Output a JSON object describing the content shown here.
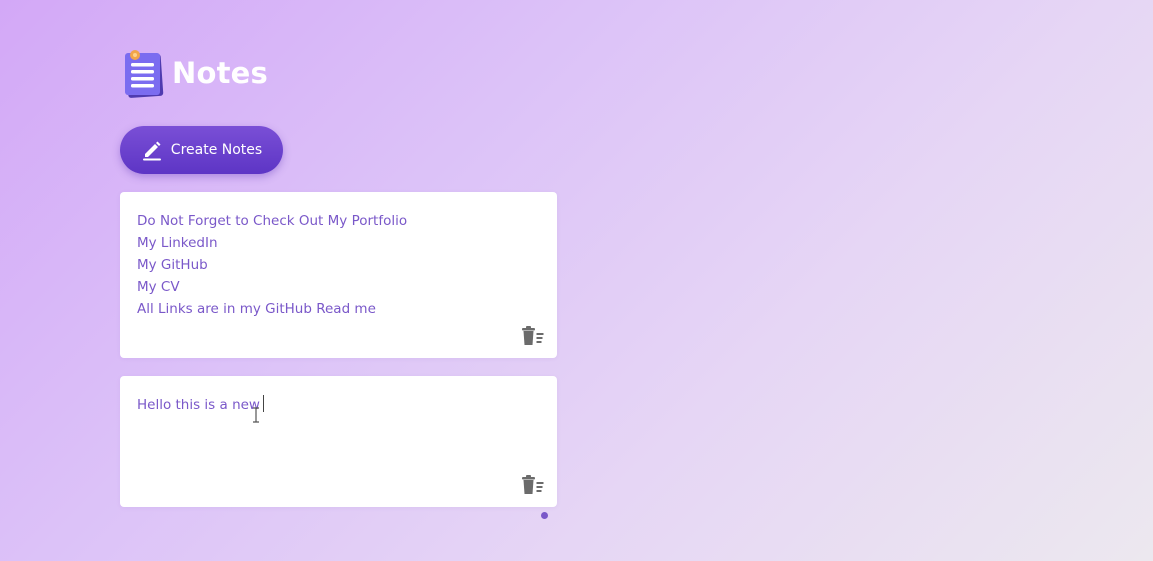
{
  "app": {
    "title": "Notes",
    "logo_icon": "notepad-icon"
  },
  "toolbar": {
    "create_label": "Create Notes",
    "create_icon": "pencil-icon"
  },
  "notes": [
    {
      "lines": [
        "Do Not Forget to Check Out My Portfolio",
        "My LinkedIn",
        "My GitHub",
        "My CV",
        "All Links are in my GitHub Read me"
      ],
      "delete_icon": "trash-icon"
    },
    {
      "lines": [
        "Hello this is a new"
      ],
      "delete_icon": "trash-icon"
    }
  ],
  "colors": {
    "accent": "#6a40d0",
    "note_text": "#7a58c9",
    "title_text": "#ffffff"
  }
}
